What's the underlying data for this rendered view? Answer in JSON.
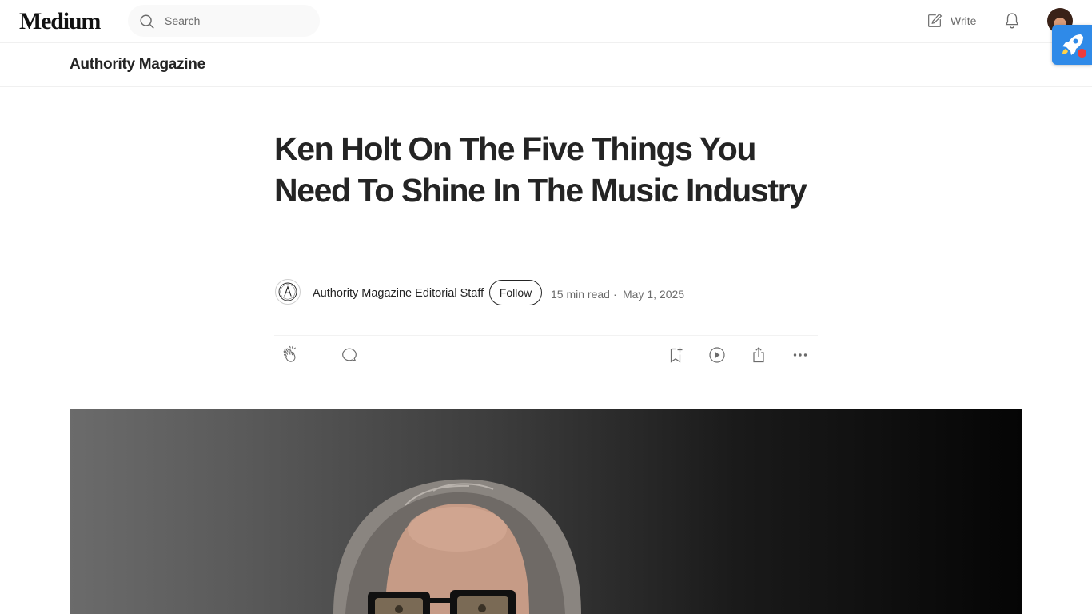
{
  "header": {
    "logo": "Medium",
    "search_placeholder": "Search",
    "write_label": "Write",
    "icons": [
      "search-icon",
      "write-icon",
      "bell-icon",
      "avatar",
      "rocket-extension-icon"
    ]
  },
  "publication": {
    "name": "Authority Magazine"
  },
  "article": {
    "title": "Ken Holt On The Five Things You Need To Shine In The Music Industry",
    "author": "Authority Magazine Editorial Staff",
    "follow_label": "Follow",
    "read_time": "15 min read",
    "separator": "·",
    "date": "May 1, 2025",
    "action_icons": [
      "clap-icon",
      "comment-icon",
      "bookmark-add-icon",
      "play-listen-icon",
      "share-icon",
      "more-icon"
    ]
  },
  "colors": {
    "text": "#242424",
    "muted": "#6b6b6b",
    "extension": "#2f8ae8"
  }
}
